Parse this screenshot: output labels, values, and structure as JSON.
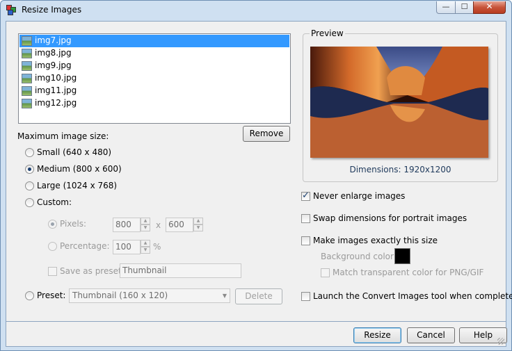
{
  "window": {
    "title": "Resize Images",
    "close_glyph": "✕",
    "min_glyph": "—",
    "max_glyph": "☐"
  },
  "files": {
    "items": [
      "img7.jpg",
      "img8.jpg",
      "img9.jpg",
      "img10.jpg",
      "img11.jpg",
      "img12.jpg"
    ],
    "selected": "img7.jpg"
  },
  "remove_label": "Remove",
  "size_section": {
    "title": "Maximum image size:",
    "small": "Small (640 x 480)",
    "medium": "Medium (800 x 600)",
    "large": "Large (1024 x 768)",
    "custom": "Custom:",
    "selected": "medium"
  },
  "custom": {
    "pixels_label": "Pixels:",
    "width": "800",
    "x_label": "x",
    "height": "600",
    "percentage_label": "Percentage:",
    "percentage": "100",
    "percent_sign": "%",
    "save_preset_label": "Save as preset:",
    "preset_name": "Thumbnail"
  },
  "preset": {
    "label": "Preset:",
    "value": "Thumbnail (160 x 120)",
    "delete_label": "Delete"
  },
  "preview": {
    "title": "Preview",
    "dimensions": "Dimensions: 1920x1200"
  },
  "options": {
    "never_enlarge": {
      "label": "Never enlarge images",
      "checked": true
    },
    "swap_dimensions": {
      "label": "Swap dimensions for portrait images",
      "checked": false
    },
    "exact_size": {
      "label": "Make images exactly this size",
      "checked": false
    },
    "background_color_label": "Background color:",
    "background_color": "#000000",
    "match_transparent": {
      "label": "Match transparent color for PNG/GIF",
      "checked": false
    },
    "launch_convert": {
      "label": "Launch the Convert Images tool when complete",
      "checked": false
    }
  },
  "buttons": {
    "resize": "Resize",
    "cancel": "Cancel",
    "help": "Help"
  }
}
